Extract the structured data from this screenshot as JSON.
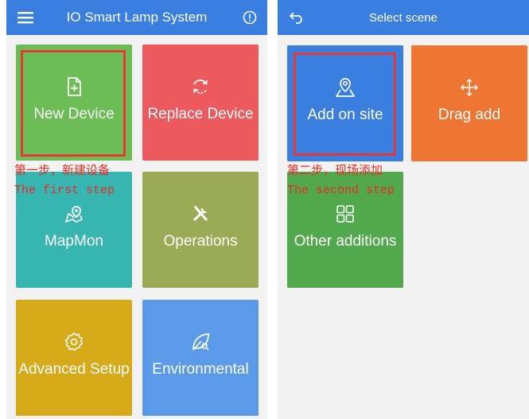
{
  "left": {
    "title": "IO Smart Lamp System",
    "tiles": [
      {
        "label": "New Device",
        "color": "#6cbd55",
        "icon": "file-plus-icon"
      },
      {
        "label": "Replace Device",
        "color": "#ec5a5d",
        "icon": "refresh-icon"
      },
      {
        "label": "MapMon",
        "color": "#37b5b1",
        "icon": "map-pin-icon"
      },
      {
        "label": "Operations",
        "color": "#9baa55",
        "icon": "tools-icon"
      },
      {
        "label": "Advanced Setup",
        "color": "#d7aa19",
        "icon": "gear-icon"
      },
      {
        "label": "Environmental",
        "color": "#5b9ae9",
        "icon": "leaf-icon"
      }
    ],
    "annotation_cn": "第一步，新建设备",
    "annotation_en": "The first step"
  },
  "right": {
    "title": "Select scene",
    "tiles": [
      {
        "label": "Add on site",
        "color": "#3a7fe0",
        "icon": "map-location-icon"
      },
      {
        "label": "Drag add",
        "color": "#ef7632",
        "icon": "move-arrows-icon"
      },
      {
        "label": "Other additions",
        "color": "#52a84d",
        "icon": "grid-icon"
      }
    ],
    "annotation_cn": "第二步，现场添加",
    "annotation_en": "The second step"
  },
  "colors": {
    "appbar": "#3a7fe0",
    "highlight": "#e43a35",
    "annotation": "#ee2a24",
    "background": "#f2f2f2"
  }
}
